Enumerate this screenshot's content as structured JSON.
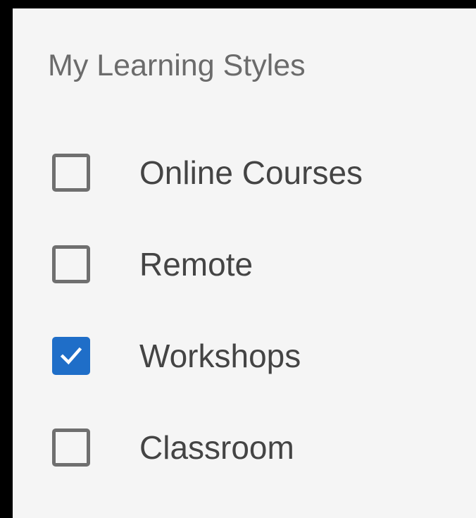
{
  "group": {
    "label": "My Learning Styles"
  },
  "options": [
    {
      "label": "Online Courses",
      "checked": false
    },
    {
      "label": "Remote",
      "checked": false
    },
    {
      "label": "Workshops",
      "checked": true
    },
    {
      "label": "Classroom",
      "checked": false
    }
  ],
  "colors": {
    "accent": "#1f6ec8",
    "panel_bg": "#f5f5f5",
    "frame": "#000000",
    "label_text": "#6b6b6b",
    "option_text": "#444444",
    "checkbox_border": "#6f6f6f"
  }
}
